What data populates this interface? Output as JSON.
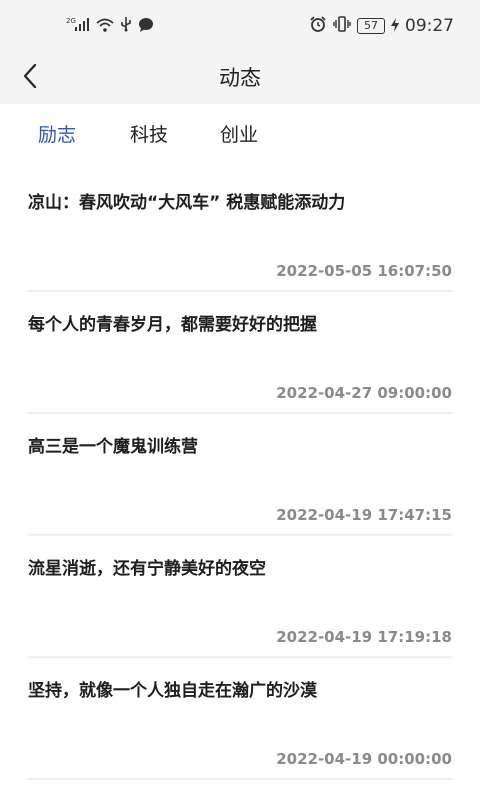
{
  "status_bar": {
    "network": "2G",
    "battery": "57",
    "time": "09:27",
    "icons": [
      "signal-icon",
      "wifi-icon",
      "usb-icon",
      "message-icon",
      "alarm-icon",
      "vibrate-icon",
      "battery-icon",
      "charging-icon"
    ]
  },
  "header": {
    "title": "动态",
    "back_icon": "chevron-left-icon"
  },
  "tabs": [
    {
      "label": "励志",
      "active": true
    },
    {
      "label": "科技",
      "active": false
    },
    {
      "label": "创业",
      "active": false
    }
  ],
  "colors": {
    "accent": "#2b56c8",
    "bar_bg": "#f4f4f4",
    "time_text": "#8a8a8a"
  },
  "articles": [
    {
      "title": "凉山：春风吹动“大风车” 税惠赋能添动力",
      "time": "2022-05-05 16:07:50"
    },
    {
      "title": "每个人的青春岁月，都需要好好的把握",
      "time": "2022-04-27 09:00:00"
    },
    {
      "title": "高三是一个魔鬼训练营",
      "time": "2022-04-19 17:47:15"
    },
    {
      "title": "流星消逝，还有宁静美好的夜空",
      "time": "2022-04-19 17:19:18"
    },
    {
      "title": "坚持，就像一个人独自走在瀚广的沙漠",
      "time": "2022-04-19 00:00:00"
    }
  ]
}
